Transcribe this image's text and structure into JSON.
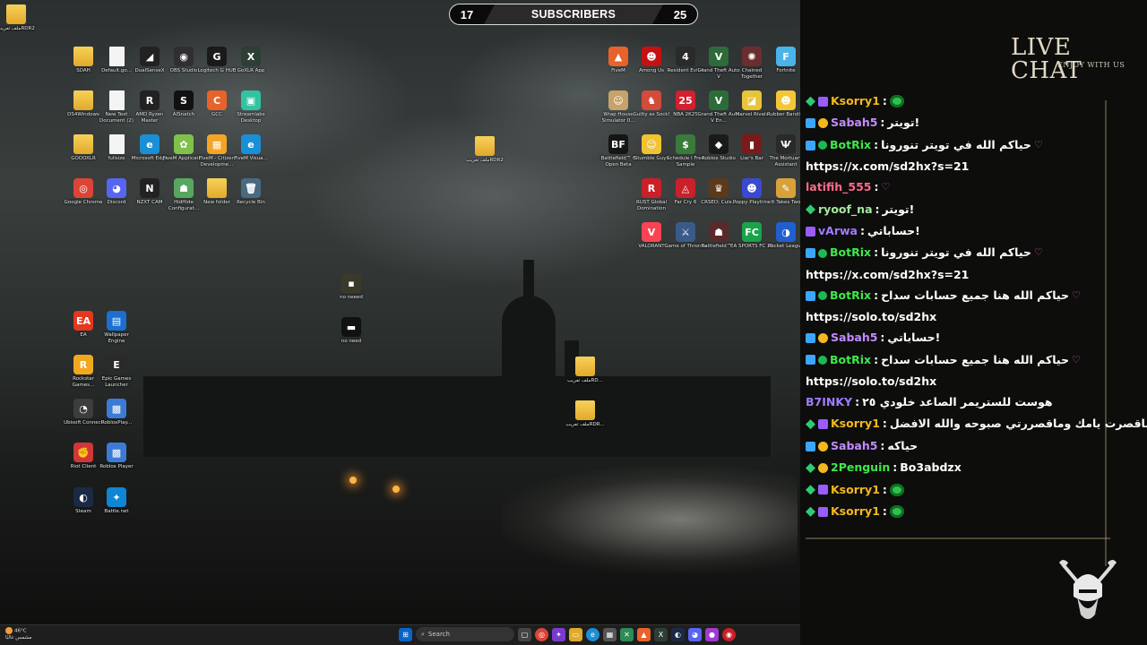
{
  "subscribers": {
    "current": "17",
    "label": "SUBSCRIBERS",
    "goal": "25"
  },
  "desktop_icons": [
    {
      "label": "ملف تعريبRDR2",
      "kind": "folder",
      "glyph": ""
    },
    {
      "label": "SDAH",
      "kind": "folder",
      "glyph": ""
    },
    {
      "label": "Default.go...",
      "kind": "file",
      "glyph": ""
    },
    {
      "label": "DualSenseX",
      "kind": "app",
      "glyph": "◢",
      "color": "#222222"
    },
    {
      "label": "OBS Studio",
      "kind": "app",
      "glyph": "◉",
      "color": "#302e31"
    },
    {
      "label": "Logitech G HUB",
      "kind": "app",
      "glyph": "G",
      "color": "#1a1a1a"
    },
    {
      "label": "GoXLR App",
      "kind": "app",
      "glyph": "X",
      "color": "#2c3e36"
    },
    {
      "label": "DS4Windows",
      "kind": "folder",
      "glyph": ""
    },
    {
      "label": "New Text Document (2)",
      "kind": "file",
      "glyph": ""
    },
    {
      "label": "AMD Ryzen Master",
      "kind": "app",
      "glyph": "R",
      "color": "#222222"
    },
    {
      "label": "AISnatch",
      "kind": "app",
      "glyph": "S",
      "color": "#111111"
    },
    {
      "label": "GCC",
      "kind": "app",
      "glyph": "C",
      "color": "#e8632b"
    },
    {
      "label": "Streamlabs Desktop",
      "kind": "app",
      "glyph": "▣",
      "color": "#31c3a2"
    },
    {
      "label": "GOOOXLR",
      "kind": "folder",
      "glyph": ""
    },
    {
      "label": "fullsize",
      "kind": "file",
      "glyph": ""
    },
    {
      "label": "Microsoft Edge",
      "kind": "app",
      "glyph": "e",
      "color": "#1b8fd6"
    },
    {
      "label": "FiveM Applicati...",
      "kind": "app",
      "glyph": "✿",
      "color": "#7fc24a"
    },
    {
      "label": "FiveM - Citizen Developme...",
      "kind": "app",
      "glyph": "▦",
      "color": "#f3a526"
    },
    {
      "label": "FiveM Visua...",
      "kind": "app",
      "glyph": "e",
      "color": "#1b8fd6"
    },
    {
      "label": "Google Chrome",
      "kind": "app",
      "glyph": "◎",
      "color": "#db4437"
    },
    {
      "label": "Discord",
      "kind": "app",
      "glyph": "◕",
      "color": "#5865f2"
    },
    {
      "label": "NZXT CAM",
      "kind": "app",
      "glyph": "N",
      "color": "#222222"
    },
    {
      "label": "HidHide Configurat...",
      "kind": "app",
      "glyph": "☗",
      "color": "#56a860"
    },
    {
      "label": "New folder",
      "kind": "folder",
      "glyph": ""
    },
    {
      "label": "Recycle Bin",
      "kind": "app",
      "glyph": "🗑",
      "color": "#4a6a80"
    },
    {
      "label": "EA",
      "kind": "app",
      "glyph": "EA",
      "color": "#e4381f"
    },
    {
      "label": "Wallpaper Engine",
      "kind": "app",
      "glyph": "▤",
      "color": "#1a6fd0"
    },
    {
      "label": "Rockstar Games...",
      "kind": "app",
      "glyph": "R",
      "color": "#f1a81f"
    },
    {
      "label": "Epic Games Launcher",
      "kind": "app",
      "glyph": "E",
      "color": "#2a2a2a"
    },
    {
      "label": "Ubisoft Connect",
      "kind": "app",
      "glyph": "◔",
      "color": "#3d3d3d"
    },
    {
      "label": "RobloxPlay...",
      "kind": "app",
      "glyph": "▩",
      "color": "#3b7bd6"
    },
    {
      "label": "Riot Client",
      "kind": "app",
      "glyph": "✊",
      "color": "#d13639"
    },
    {
      "label": "Roblox Player",
      "kind": "app",
      "glyph": "▩",
      "color": "#3b7bd6"
    },
    {
      "label": "Steam",
      "kind": "app",
      "glyph": "◐",
      "color": "#1a2a45"
    },
    {
      "label": "Battle.net",
      "kind": "app",
      "glyph": "✦",
      "color": "#0e86d4"
    },
    {
      "label": "no neeed",
      "kind": "app",
      "glyph": "▪",
      "color": "#3a3a2a"
    },
    {
      "label": "no need",
      "kind": "app",
      "glyph": "▬",
      "color": "#111111"
    },
    {
      "label": "ملف تعريبRDR2",
      "kind": "folder",
      "glyph": ""
    },
    {
      "label": "ملف تعريبRD...",
      "kind": "folder",
      "glyph": ""
    },
    {
      "label": "ملف تعريبRDR...",
      "kind": "folder",
      "glyph": ""
    },
    {
      "label": "FiveM",
      "kind": "app",
      "glyph": "▲",
      "color": "#e8632b"
    },
    {
      "label": "Among Us",
      "kind": "app",
      "glyph": "☻",
      "color": "#c51111"
    },
    {
      "label": "Resident Evil 4",
      "kind": "app",
      "glyph": "4",
      "color": "#2a2a2a"
    },
    {
      "label": "Grand Theft Auto V",
      "kind": "app",
      "glyph": "V",
      "color": "#2e6b3a"
    },
    {
      "label": "Chained Together",
      "kind": "app",
      "glyph": "✺",
      "color": "#6a2e2e"
    },
    {
      "label": "Fortnite",
      "kind": "app",
      "glyph": "F",
      "color": "#4ab4e8"
    },
    {
      "label": "Wrap House Simulator 0...",
      "kind": "app",
      "glyph": "☺",
      "color": "#c6a36a"
    },
    {
      "label": "Guilty as Sock!",
      "kind": "app",
      "glyph": "♞",
      "color": "#d24b3b"
    },
    {
      "label": "NBA 2K25",
      "kind": "app",
      "glyph": "25",
      "color": "#d1202f"
    },
    {
      "label": "Grand Theft Auto V En...",
      "kind": "app",
      "glyph": "V",
      "color": "#2e6b3a"
    },
    {
      "label": "Marvel Rivals",
      "kind": "app",
      "glyph": "◪",
      "color": "#e8c43a"
    },
    {
      "label": "Rubber Bandits",
      "kind": "app",
      "glyph": "☻",
      "color": "#f4c637"
    },
    {
      "label": "Battlefield™ 6 Open Beta",
      "kind": "app",
      "glyph": "BF",
      "color": "#151515"
    },
    {
      "label": "Stumble Guys",
      "kind": "app",
      "glyph": "☺",
      "color": "#f1c232"
    },
    {
      "label": "Schedule I Free Sample",
      "kind": "app",
      "glyph": "$",
      "color": "#3a7a3a"
    },
    {
      "label": "Roblox Studio",
      "kind": "app",
      "glyph": "◆",
      "color": "#1a1a1a"
    },
    {
      "label": "Liar's Bar",
      "kind": "app",
      "glyph": "▮",
      "color": "#7a1a1a"
    },
    {
      "label": "The Mortuary Assistant",
      "kind": "app",
      "glyph": "Ѱ",
      "color": "#2a2a2a"
    },
    {
      "label": "RUST Global Domination",
      "kind": "app",
      "glyph": "R",
      "color": "#c9202a"
    },
    {
      "label": "Far Cry 6",
      "kind": "app",
      "glyph": "◬",
      "color": "#c9202a"
    },
    {
      "label": "CRSED: Cuis...",
      "kind": "app",
      "glyph": "♛",
      "color": "#5a3a1a"
    },
    {
      "label": "Poppy Playtime",
      "kind": "app",
      "glyph": "☻",
      "color": "#3a4ad0"
    },
    {
      "label": "It Takes Two",
      "kind": "app",
      "glyph": "✎",
      "color": "#d9a13a"
    },
    {
      "label": "VALORANT",
      "kind": "app",
      "glyph": "V",
      "color": "#fa4454"
    },
    {
      "label": "Game of Thrones",
      "kind": "app",
      "glyph": "⚔",
      "color": "#3a5a8a"
    },
    {
      "label": "Battlefield™...",
      "kind": "app",
      "glyph": "☗",
      "color": "#5a2a2a"
    },
    {
      "label": "EA SPORTS FC 25",
      "kind": "app",
      "glyph": "FC",
      "color": "#1aa34a"
    },
    {
      "label": "Rocket League",
      "kind": "app",
      "glyph": "◑",
      "color": "#1f5fd0"
    }
  ],
  "taskbar": {
    "weather_temp": "46°C",
    "weather_desc": "مشمس غالبًا",
    "search_placeholder": "Search"
  },
  "chat": {
    "title": "LIVE CHAT",
    "subtitle": "ENJOY WITH US",
    "messages": [
      {
        "user": "Ksorry1",
        "color": "#f3b81d",
        "badges": [
          "g",
          "p"
        ],
        "text": "",
        "emote": true
      },
      {
        "user": "Sabah5",
        "color": "#c38cff",
        "badges": [
          "bl",
          "y"
        ],
        "text": "تويتر!"
      },
      {
        "user": "BotRix",
        "color": "#3fe84a",
        "badges": [
          "bl",
          "v"
        ],
        "text": "حياكم الله في تويتر تنورونا",
        "heart": true
      },
      {
        "url": "https://x.com/sd2hx?s=21"
      },
      {
        "user": "latifih_555",
        "color": "#ff6a8a",
        "badges": [],
        "text": "",
        "heart": true
      },
      {
        "user": "ryoof_na",
        "color": "#a6e8a0",
        "badges": [
          "g"
        ],
        "text": "تويتر!"
      },
      {
        "user": "vArwa",
        "color": "#a07cff",
        "badges": [
          "p"
        ],
        "text": "حساباتي!"
      },
      {
        "user": "BotRix",
        "color": "#3fe84a",
        "badges": [
          "bl",
          "v"
        ],
        "text": "حياكم الله في تويتر تنورونا",
        "heart": true
      },
      {
        "url": "https://x.com/sd2hx?s=21"
      },
      {
        "user": "BotRix",
        "color": "#3fe84a",
        "badges": [
          "bl",
          "v"
        ],
        "text": "حياكم الله هنا جميع حسابات سداح",
        "heart": true
      },
      {
        "url": "https://solo.to/sd2hx"
      },
      {
        "user": "Sabah5",
        "color": "#c38cff",
        "badges": [
          "bl",
          "y"
        ],
        "text": "حساباتي!"
      },
      {
        "user": "BotRix",
        "color": "#3fe84a",
        "badges": [
          "bl",
          "v"
        ],
        "text": "حياكم الله هنا جميع حسابات سداح",
        "heart": true
      },
      {
        "url": "https://solo.to/sd2hx"
      },
      {
        "user": "B7INKY",
        "color": "#a07cff",
        "badges": [],
        "text": "هوست للستريمر الصاعد خلودي ٢٥"
      },
      {
        "user": "Ksorry1",
        "color": "#f3b81d",
        "badges": [
          "g",
          "p"
        ],
        "text": "ماقصرت يامك وماقصررتي صبوحه والله الافضل"
      },
      {
        "user": "Sabah5",
        "color": "#c38cff",
        "badges": [
          "bl",
          "y"
        ],
        "text": "حياكه"
      },
      {
        "user": "2Penguin",
        "color": "#3fe84a",
        "badges": [
          "g",
          "y"
        ],
        "text": "Bo3abdzx"
      },
      {
        "user": "Ksorry1",
        "color": "#f3b81d",
        "badges": [
          "g",
          "p"
        ],
        "text": "",
        "emote": true
      },
      {
        "user": "Ksorry1",
        "color": "#f3b81d",
        "badges": [
          "g",
          "p"
        ],
        "text": "",
        "emote": true
      }
    ]
  }
}
